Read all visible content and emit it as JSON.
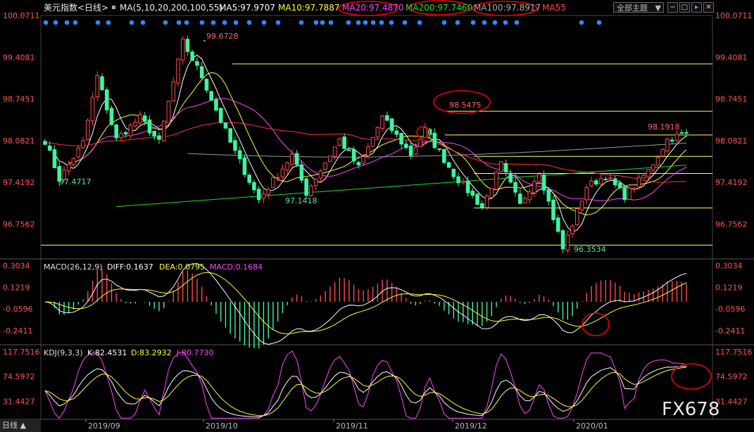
{
  "header": {
    "symbol": "美元指数<日线>",
    "ma_params": "MA(5,10,20,200,100,55)",
    "ma5": "MA5:97.9707",
    "ma10": "MA10:97.7887",
    "ma20": "MA20:97.4870",
    "ma200": "MA200:97.7460",
    "ma100": "MA100:97.8917",
    "ma55": "MA55",
    "theme_select": "全部主题",
    "btn_minus": "−",
    "btn_box": "▢",
    "btn_arrow": "▸",
    "btn_x": "✕"
  },
  "colors": {
    "up": "#ff4a4a",
    "down": "#3ff4a0",
    "ma5": "#ffffff",
    "ma10": "#ffff33",
    "ma20": "#ff44ff",
    "ma55": "#ff3333",
    "ma100": "#999999",
    "ma200": "#22dd22",
    "axis_text": "#ff5555",
    "hline": "#ffff66",
    "circle": "#ee0000",
    "dots": "#2a8cff",
    "low_label": "#5fe0a8",
    "high_label": "#ff6070"
  },
  "chart_data": [
    {
      "type": "candlestick",
      "title": "美元指数<日线>",
      "ylim": [
        96.2,
        100.0711
      ],
      "y_ticks": [
        "100.0711",
        "99.4081",
        "98.7451",
        "98.0821",
        "97.4192",
        "96.7562"
      ],
      "x_ticks": [
        "2019/09",
        "2019/10",
        "2019/11",
        "2019/12",
        "2020/01"
      ],
      "annotations": {
        "high_1": "99.6728",
        "high_2": "98.5475",
        "high_3": "98.1918",
        "low_1": "97.4717",
        "low_2": "97.1418",
        "low_3": "96.3534"
      },
      "horizontal_levels": [
        99.3,
        98.5475,
        98.17,
        97.83,
        97.56,
        97.01,
        96.42
      ],
      "pivots": [
        [
          0,
          98.08
        ],
        [
          3,
          97.47
        ],
        [
          8,
          98.05
        ],
        [
          11,
          99.1
        ],
        [
          15,
          98.1
        ],
        [
          20,
          98.45
        ],
        [
          24,
          98.05
        ],
        [
          29,
          99.65
        ],
        [
          33,
          99.1
        ],
        [
          39,
          98.05
        ],
        [
          45,
          97.14
        ],
        [
          52,
          97.85
        ],
        [
          55,
          97.25
        ],
        [
          62,
          98.1
        ],
        [
          66,
          97.65
        ],
        [
          71,
          98.45
        ],
        [
          77,
          97.86
        ],
        [
          80,
          98.25
        ],
        [
          86,
          97.55
        ],
        [
          92,
          97.02
        ],
        [
          96,
          97.7
        ],
        [
          100,
          97.05
        ],
        [
          104,
          97.6
        ],
        [
          109,
          96.36
        ],
        [
          114,
          97.35
        ],
        [
          118,
          97.52
        ],
        [
          122,
          97.2
        ],
        [
          127,
          97.6
        ],
        [
          131,
          98.1
        ],
        [
          134,
          98.18
        ]
      ]
    },
    {
      "type": "line",
      "title": "MACD(26,12,9)",
      "diff_label": "DIFF:0.1637",
      "dea_label": "DEA:0.0795",
      "macd_label": "MACD:0.1684",
      "ylim": [
        -0.36,
        0.36
      ],
      "y_ticks": [
        "0.3034",
        "0.1219",
        "-0.0596",
        "-0.2411"
      ]
    },
    {
      "type": "line",
      "title": "KDJ(9,3,3)",
      "k_label": "K:82.4531",
      "d_label": "D:83.2932",
      "j_label": "J:80.7730",
      "ylim": [
        0,
        130
      ],
      "y_ticks": [
        "117.7516",
        "74.5972",
        "31.4427"
      ]
    }
  ],
  "watermark": "FX678",
  "bottom_control": "日线 ▲"
}
